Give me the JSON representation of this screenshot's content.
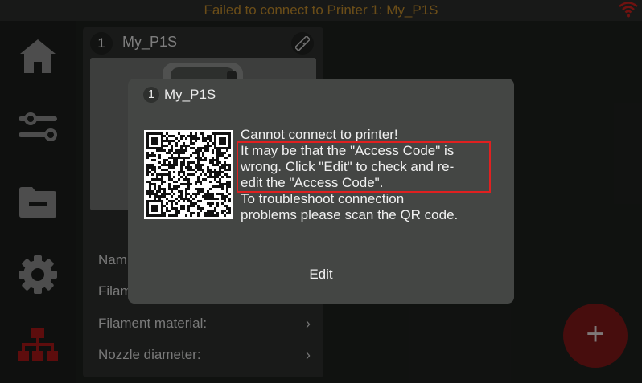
{
  "status_bar": {
    "message": "Failed to connect to Printer 1: My_P1S",
    "message_color": "#b8862a",
    "wifi_icon": "wifi-error-icon",
    "wifi_color": "#c0201c"
  },
  "sidebar": {
    "items": [
      {
        "name": "home",
        "icon": "home-icon"
      },
      {
        "name": "controls",
        "icon": "sliders-icon"
      },
      {
        "name": "files",
        "icon": "folder-icon"
      },
      {
        "name": "settings",
        "icon": "gear-icon"
      },
      {
        "name": "network",
        "icon": "network-icon",
        "active": true,
        "color": "#a01818"
      }
    ]
  },
  "printer_card": {
    "number": "1",
    "name": "My_P1S",
    "edit_icon": "ruler-edit-icon",
    "rows": [
      {
        "label": "Nam"
      },
      {
        "label": "Filam"
      },
      {
        "label": "Filament material:",
        "chevron": "›"
      },
      {
        "label": "Nozzle diameter:",
        "chevron": "›"
      }
    ]
  },
  "fab": {
    "label": "+",
    "color": "#7a1818"
  },
  "dialog": {
    "number": "1",
    "title": "My_P1S",
    "message_lines": [
      "Cannot connect to printer!",
      "It may be that the \"Access Code\" is",
      "wrong. Click \"Edit\" to check and re-",
      "edit the \"Access Code\".",
      "To troubleshoot connection",
      "problems please scan the QR code."
    ],
    "highlight_color": "#e02020",
    "edit_label": "Edit"
  }
}
